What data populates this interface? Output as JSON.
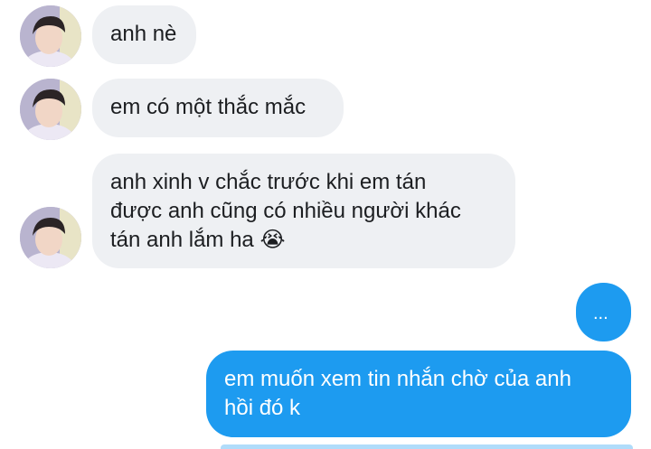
{
  "conversation": {
    "messages": [
      {
        "sender": "them",
        "text": "anh nè"
      },
      {
        "sender": "them",
        "text": "em có một thắc mắc"
      },
      {
        "sender": "them",
        "text": "anh xinh v chắc trước khi em tán\nđược anh cũng có nhiều người khác\ntán anh lắm ha 😭"
      },
      {
        "sender": "me",
        "text": "..."
      },
      {
        "sender": "me",
        "text": "em muốn xem tin nhắn chờ của anh\nhồi đó k"
      }
    ]
  },
  "colors": {
    "incoming_bubble": "#eef0f3",
    "outgoing_bubble": "#1d9bf0",
    "incoming_text": "#1c1e21",
    "outgoing_text": "#ffffff"
  },
  "icons": {
    "avatar": "avatar-portrait"
  }
}
